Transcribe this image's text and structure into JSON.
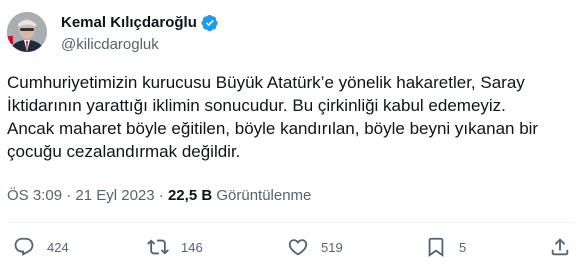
{
  "author": {
    "name": "Kemal Kılıçdaroğlu",
    "handle": "@kilicdarogluk"
  },
  "tweet": {
    "lines": [
      "Cumhuriyetimizin kurucusu Büyük Atatürk’e yönelik hakaretler, Saray",
      "İktidarının yarattığı iklimin sonucudur. Bu çirkinliği kabul edemeyiz.",
      "Ancak maharet böyle eğitilen, böyle kandırılan, böyle beyni yıkanan bir",
      "çocuğu cezalandırmak değildir."
    ]
  },
  "meta": {
    "time": "ÖS 3:09",
    "separator": " · ",
    "date": "21 Eyl 2023",
    "views_count": "22,5 B",
    "views_label": "Görüntülenme"
  },
  "actions": {
    "replies": "424",
    "retweets": "146",
    "likes": "519",
    "bookmarks": "5"
  },
  "icons": {
    "verified": "verified-badge-icon",
    "reply": "reply-icon",
    "retweet": "retweet-icon",
    "like": "heart-icon",
    "bookmark": "bookmark-icon",
    "share": "share-icon"
  },
  "colors": {
    "verified": "#1d9bf0",
    "text": "#0f1419",
    "secondary": "#536471"
  }
}
